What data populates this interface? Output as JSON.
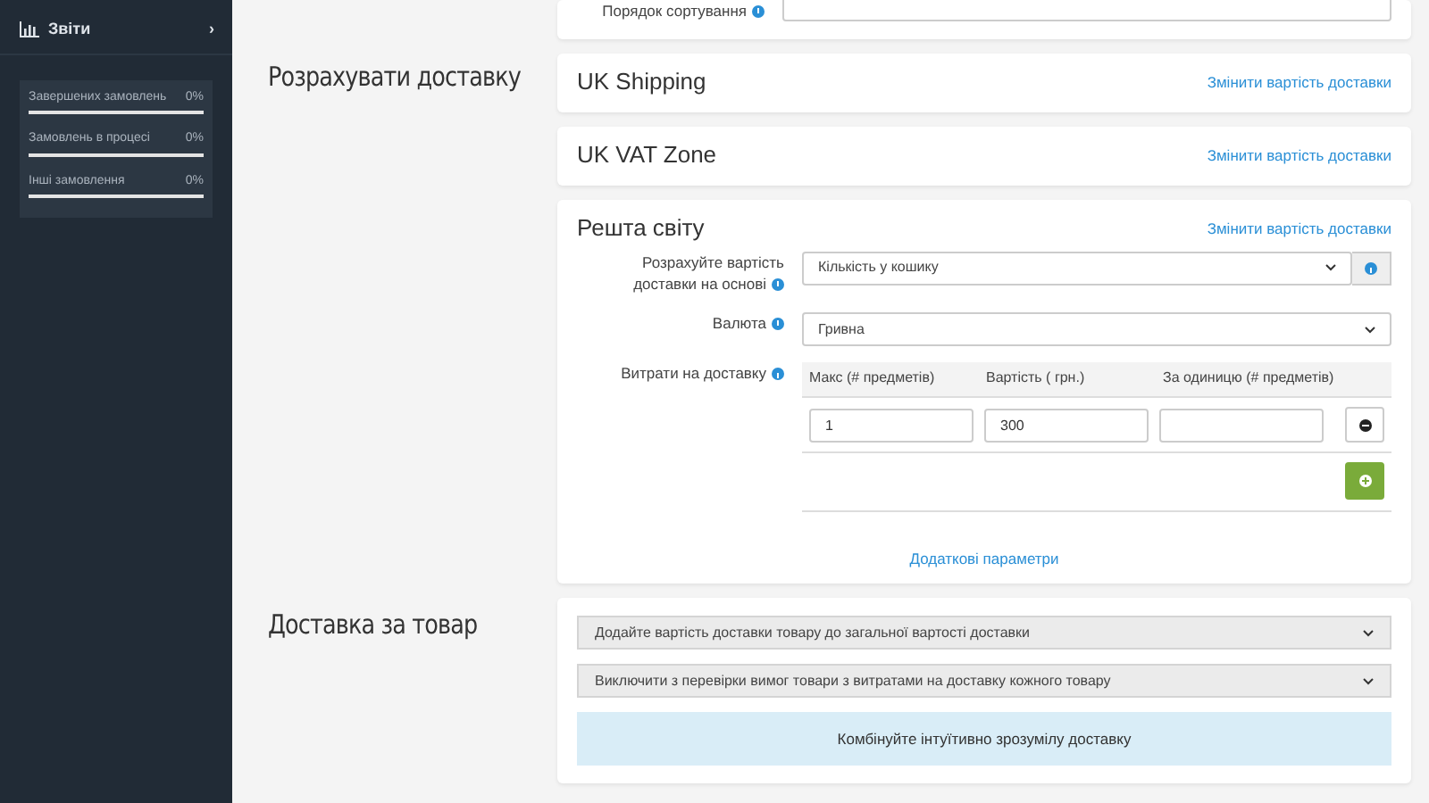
{
  "sidebar": {
    "menu_item": {
      "label": "Звіти",
      "chevron": "›"
    },
    "stats": [
      {
        "label": "Завершених замовлень",
        "value": "0%",
        "level": 0
      },
      {
        "label": "Замовлень в процесі",
        "value": "0%",
        "level": 0
      },
      {
        "label": "Інші замовлення",
        "value": "0%",
        "level": 0
      }
    ]
  },
  "top_card": {
    "label": "Порядок сортування"
  },
  "sections": [
    {
      "heading": "Розрахувати доставку",
      "zones": [
        {
          "name": "UK Shipping",
          "link": "Змінити вартість доставки",
          "expanded": false
        },
        {
          "name": "UK VAT Zone",
          "link": "Змінити вартість доставки",
          "expanded": false
        },
        {
          "name": "Решта світу",
          "link": "Змінити вартість доставки",
          "expanded": true,
          "fields": [
            {
              "label": "Розрахуйте вартість доставки на основі",
              "value": "Кількість у кошику",
              "addon": true
            },
            {
              "label": "Валюта",
              "value": "Гривна",
              "addon": false
            }
          ],
          "costs": {
            "label": "Витрати на доставку",
            "columns": [
              "Макс (# предметів)",
              "Вартість ( грн.)",
              "За одиницю (# предметів)"
            ],
            "rows": [
              [
                "1",
                "300",
                ""
              ]
            ]
          },
          "more_link": "Додаткові параметри"
        }
      ]
    },
    {
      "heading": "Доставка за товар",
      "selects": [
        "Додайте вартість доставки товару до загальної вартості доставки",
        "Виключити з перевірки вимог товари з витратами на доставку кожного товару"
      ],
      "alert": "Комбінуйте інтуїтивно зрозумілу доставку"
    }
  ]
}
